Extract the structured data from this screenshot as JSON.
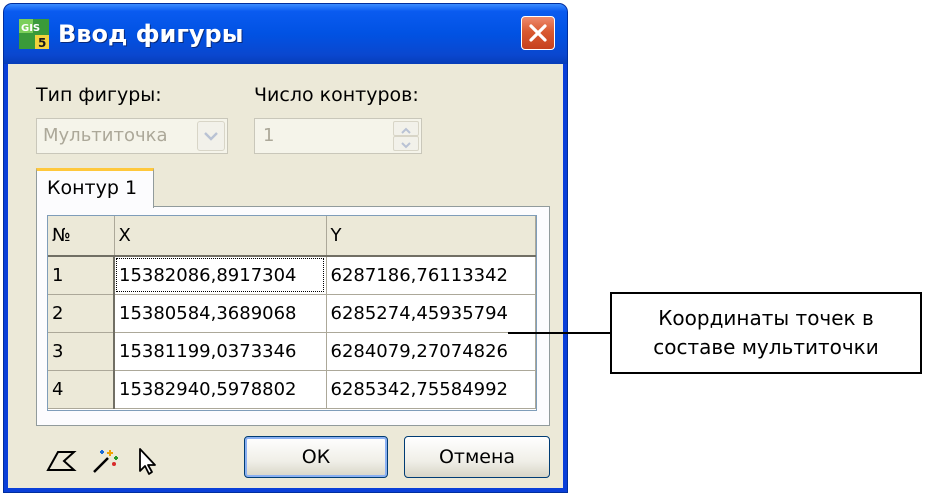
{
  "window": {
    "title": "Ввод фигуры",
    "accent_color": "#0a3fd8"
  },
  "form": {
    "figure_type_label": "Тип фигуры:",
    "figure_type_value": "Мультиточка",
    "contours_label": "Число контуров:",
    "contours_value": "1"
  },
  "tabs": [
    {
      "label": "Контур 1",
      "active": true
    }
  ],
  "grid": {
    "columns": [
      "№",
      "X",
      "Y"
    ],
    "rows": [
      {
        "n": "1",
        "x": "15382086,8917304",
        "y": "6287186,76113342"
      },
      {
        "n": "2",
        "x": "15380584,3689068",
        "y": "6285274,45935794"
      },
      {
        "n": "3",
        "x": "15381199,0373346",
        "y": "6284079,27074826"
      },
      {
        "n": "4",
        "x": "15382940,5978802",
        "y": "6285342,75584992"
      }
    ]
  },
  "tools": [
    "polygon-icon",
    "magic-wand-icon",
    "pointer-icon"
  ],
  "buttons": {
    "ok_label": "ОК",
    "cancel_label": "Отмена"
  },
  "callout": {
    "line1": "Координаты точек в",
    "line2": "составе мультиточки"
  }
}
